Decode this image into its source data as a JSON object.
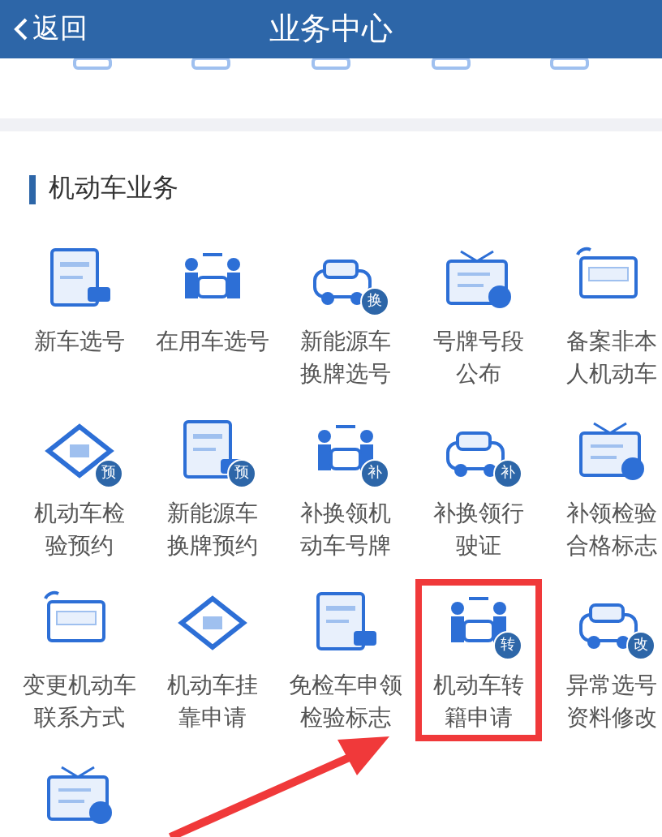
{
  "header": {
    "back": "返回",
    "title": "业务中心"
  },
  "section": {
    "title": "机动车业务"
  },
  "items": [
    {
      "lines": [
        "新车选号"
      ],
      "highlighted": false
    },
    {
      "lines": [
        "在用车选号"
      ],
      "highlighted": false
    },
    {
      "lines": [
        "新能源车",
        "换牌选号"
      ],
      "badge": "换",
      "highlighted": false
    },
    {
      "lines": [
        "号牌号段",
        "公布"
      ],
      "highlighted": false
    },
    {
      "lines": [
        "备案非本",
        "人机动车"
      ],
      "highlighted": false
    },
    {
      "lines": [
        "机动车检",
        "验预约"
      ],
      "badge": "预",
      "highlighted": false
    },
    {
      "lines": [
        "新能源车",
        "换牌预约"
      ],
      "badge": "预",
      "highlighted": false
    },
    {
      "lines": [
        "补换领机",
        "动车号牌"
      ],
      "badge": "补",
      "highlighted": false
    },
    {
      "lines": [
        "补换领行",
        "驶证"
      ],
      "badge": "补",
      "highlighted": false
    },
    {
      "lines": [
        "补领检验",
        "合格标志"
      ],
      "highlighted": false
    },
    {
      "lines": [
        "变更机动车",
        "联系方式"
      ],
      "highlighted": false
    },
    {
      "lines": [
        "机动车挂",
        "靠申请"
      ],
      "highlighted": false
    },
    {
      "lines": [
        "免检车申领",
        "检验标志"
      ],
      "highlighted": false
    },
    {
      "lines": [
        "机动车转",
        "籍申请"
      ],
      "badge": "转",
      "highlighted": true
    },
    {
      "lines": [
        "异常选号",
        "资料修改"
      ],
      "badge": "改",
      "highlighted": false
    },
    {
      "highlighted": false
    }
  ]
}
